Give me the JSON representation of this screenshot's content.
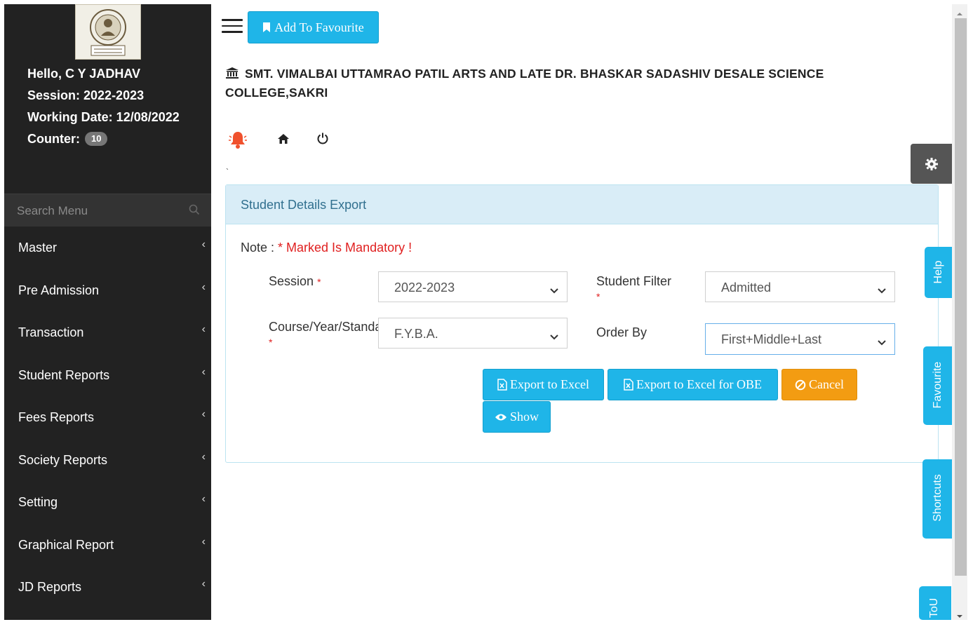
{
  "sidebar": {
    "user": {
      "hello": "Hello, C Y JADHAV",
      "session": "Session: 2022-2023",
      "working_date": "Working Date: 12/08/2022",
      "counter_label": "Counter:",
      "counter_value": "10"
    },
    "search_placeholder": "Search Menu",
    "menu": [
      {
        "label": "Master"
      },
      {
        "label": "Pre Admission"
      },
      {
        "label": "Transaction"
      },
      {
        "label": "Student Reports"
      },
      {
        "label": "Fees Reports"
      },
      {
        "label": "Society Reports"
      },
      {
        "label": "Setting"
      },
      {
        "label": "Graphical Report"
      },
      {
        "label": "JD Reports"
      }
    ],
    "chevron": "‹"
  },
  "topbar": {
    "favourite_label": "Add To Favourite"
  },
  "college": {
    "name": "SMT. VIMALBAI UTTAMRAO PATIL ARTS AND LATE DR. BHASKAR SADASHIV DESALE SCIENCE COLLEGE,SAKRI"
  },
  "misc": {
    "backtick": "`"
  },
  "panel": {
    "title": "Student Details Export",
    "note_prefix": "Note : ",
    "note_text": "* Marked Is Mandatory !",
    "fields": {
      "session": {
        "label": "Session",
        "value": "2022-2023"
      },
      "student_filter": {
        "label": "Student Filter",
        "value": "Admitted"
      },
      "course": {
        "label": "Course/Year/Standard",
        "value": "F.Y.B.A."
      },
      "order_by": {
        "label": "Order By",
        "value": "First+Middle+Last"
      }
    },
    "required_mark": "*",
    "buttons": {
      "export_excel": "Export to Excel",
      "export_excel_obe": "Export to Excel for OBE",
      "cancel": "Cancel",
      "show": "Show"
    }
  },
  "side_tabs": {
    "help": "Help",
    "favourite": "Favourite",
    "shortcuts": "Shortcuts",
    "tou": "ToU"
  },
  "colors": {
    "sidebar_bg": "#222222",
    "accent": "#1fb5e8",
    "warning": "#f39c12",
    "panel_head_bg": "#d9edf7",
    "required": "#e02020"
  }
}
